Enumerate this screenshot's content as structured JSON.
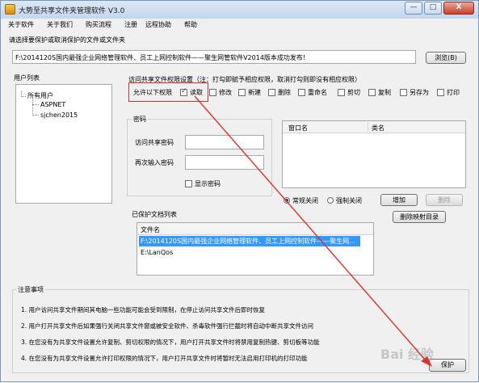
{
  "window": {
    "title": "大势至共享文件夹管理软件 V3.0",
    "minimize_glyph": "—",
    "maximize_glyph": "□",
    "close_glyph": "X"
  },
  "menu": [
    "关于软件",
    "关于我们",
    "购买流程",
    "注册",
    "远程协助",
    "帮助"
  ],
  "folder": {
    "prompt": "请选择要保护或取消保护的文件或文件夹",
    "path": "F:\\2014120S国内最强企业网络管理软件、员工上网控制软件——聚生网管软件V2014版本成功发布!",
    "browse_label": "浏览(B)"
  },
  "users": {
    "title": "用户列表",
    "root": "所有用户",
    "items": [
      "ASPNET",
      "sjchen2015"
    ]
  },
  "permissions": {
    "title": "访问共享文件权限设置（注：打勾即赋予相应权限，取消打勾则即没有相应权限）",
    "allow_label": "允许以下权限",
    "items": [
      {
        "label": "读取",
        "checked": true
      },
      {
        "label": "修改",
        "checked": false
      },
      {
        "label": "新建",
        "checked": false
      },
      {
        "label": "删除",
        "checked": false
      },
      {
        "label": "重命名",
        "checked": false
      },
      {
        "label": "剪切",
        "checked": false
      },
      {
        "label": "复制",
        "checked": false
      },
      {
        "label": "另存为",
        "checked": false
      },
      {
        "label": "打印",
        "checked": false
      }
    ]
  },
  "password": {
    "title": "密码",
    "access_label": "访问共享密码",
    "confirm_label": "再次输入密码",
    "show_label": "显示密码"
  },
  "windows_list": {
    "col_name": "窗口名",
    "col_class": "类名"
  },
  "close_mode": {
    "normal_label": "常规关闭",
    "force_label": "强制关闭",
    "add_label": "增加",
    "delete_label": "删除",
    "remove_map_label": "删除映射目录"
  },
  "protected": {
    "title": "已保护文档列表",
    "col": "文件名",
    "rows": [
      "F:\\2014120S国内最强企业网络管理软件、员工上网控制软件——聚生网...",
      "E:\\LanQos"
    ]
  },
  "notes": {
    "title": "注意事项",
    "items": [
      "1. 用户访问共享文件期间其电脑一些功能可能会受到限制，在停止访问共享文件后即时恢复",
      "2. 用户打开共享文件后如果强行关闭共享文件窗或被安全软件、杀毒软件强行拦截时将自动中断共享文件访问",
      "3. 在您没有为共享文件设置允许复制、剪切权限的情况下，用户打开共享文件时将禁用复制热键、剪切板等功能",
      "4. 在您没有为共享文件设置允许打印权限的情况下，用户打开共享文件时将暂时无法启用打印机的打印功能"
    ],
    "protect_label": "保护"
  },
  "watermark": "Bai 经验"
}
